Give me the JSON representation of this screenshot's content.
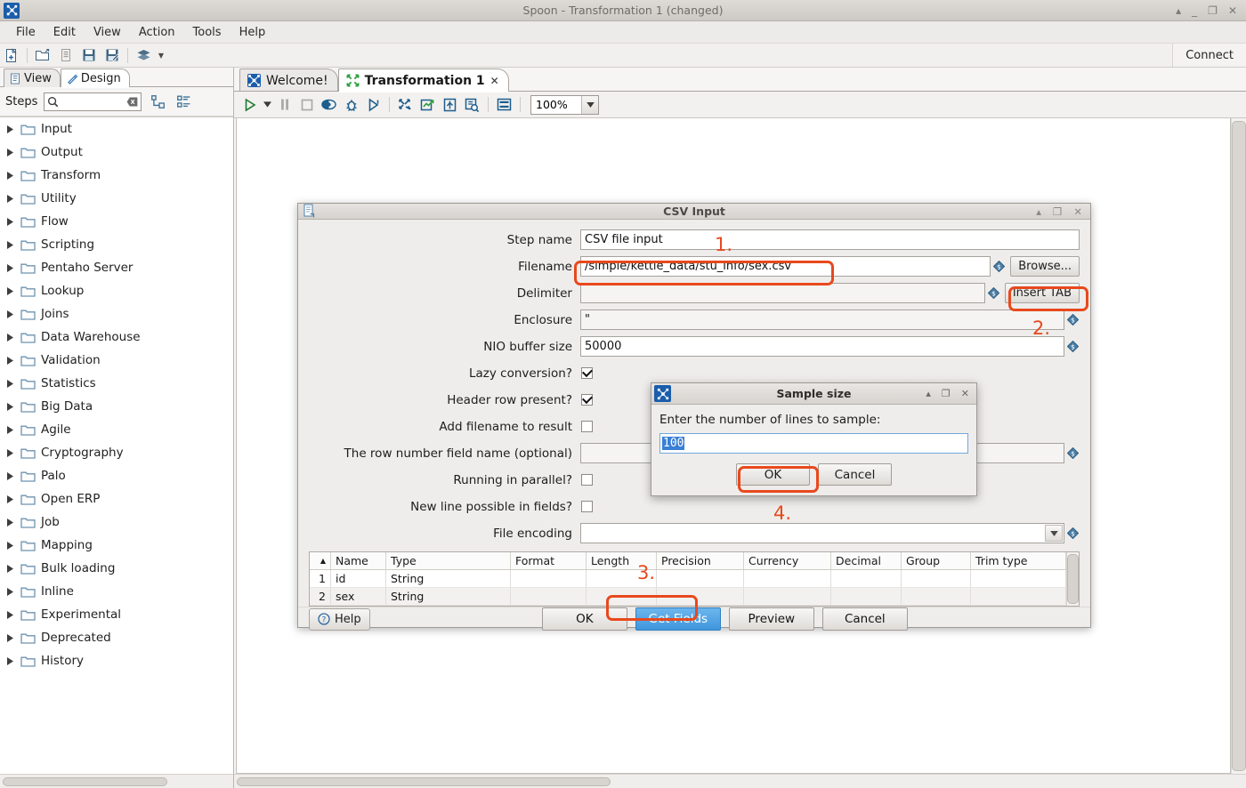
{
  "window": {
    "title": "Spoon - Transformation 1 (changed)",
    "buttons": {
      "minimize": "▴",
      "restore": "_",
      "maximize": "❐",
      "close": "✕"
    }
  },
  "menubar": {
    "items": [
      "File",
      "Edit",
      "View",
      "Action",
      "Tools",
      "Help"
    ]
  },
  "main_toolbar": {
    "connect_label": "Connect",
    "icons": [
      "new-file-icon",
      "open-folder-icon",
      "explorer-icon",
      "save-icon",
      "save-as-icon",
      "layers-icon",
      "dropdown-caret-icon"
    ]
  },
  "left_panel": {
    "tabs": [
      {
        "label": "View",
        "icon": "document-icon",
        "active": false
      },
      {
        "label": "Design",
        "icon": "pencil-icon",
        "active": true
      }
    ],
    "steps_label": "Steps",
    "search": {
      "value": "",
      "placeholder": ""
    },
    "tree_items": [
      "Input",
      "Output",
      "Transform",
      "Utility",
      "Flow",
      "Scripting",
      "Pentaho Server",
      "Lookup",
      "Joins",
      "Data Warehouse",
      "Validation",
      "Statistics",
      "Big Data",
      "Agile",
      "Cryptography",
      "Palo",
      "Open ERP",
      "Job",
      "Mapping",
      "Bulk loading",
      "Inline",
      "Experimental",
      "Deprecated",
      "History"
    ]
  },
  "editor": {
    "tabs": [
      {
        "label": "Welcome!",
        "icon": "spoon-icon",
        "active": false,
        "closable": false
      },
      {
        "label": "Transformation 1",
        "icon": "transformation-icon",
        "active": true,
        "closable": true,
        "close_glyph": "✕"
      }
    ],
    "zoom": {
      "value": "100%"
    },
    "toolbar_icons": [
      "run-icon",
      "run-options-caret-icon",
      "pause-icon",
      "stop-icon",
      "preview-icon",
      "debug-icon",
      "replay-icon",
      "transformation-metrics-icon",
      "transformation-log-icon",
      "step-metrics-icon",
      "inspect-data-icon",
      "grid-icon"
    ]
  },
  "csv_dialog": {
    "title": "CSV Input",
    "window_buttons": {
      "minimize": "▴",
      "maximize": "❐",
      "close": "✕"
    },
    "fields": [
      {
        "label": "Step name",
        "value": "CSV file input",
        "type": "text",
        "variable": false,
        "button": null
      },
      {
        "label": "Filename",
        "value": "/simple/kettle_data/stu_info/sex.csv",
        "type": "text",
        "variable": true,
        "button": "Browse..."
      },
      {
        "label": "Delimiter",
        "value": "",
        "type": "text",
        "variable": true,
        "button": "Insert TAB"
      },
      {
        "label": "Enclosure",
        "value": "\"",
        "type": "text",
        "variable": true,
        "button": null
      },
      {
        "label": "NIO buffer size",
        "value": "50000",
        "type": "text",
        "variable": true,
        "button": null
      },
      {
        "label": "Lazy conversion?",
        "value": true,
        "type": "checkbox",
        "variable": false,
        "button": null
      },
      {
        "label": "Header row present?",
        "value": true,
        "type": "checkbox",
        "variable": false,
        "button": null
      },
      {
        "label": "Add filename to result",
        "value": false,
        "type": "checkbox",
        "variable": false,
        "button": null
      },
      {
        "label": "The row number field name (optional)",
        "value": "",
        "type": "text",
        "variable": true,
        "button": null
      },
      {
        "label": "Running in parallel?",
        "value": false,
        "type": "checkbox",
        "variable": false,
        "button": null
      },
      {
        "label": "New line possible in fields?",
        "value": false,
        "type": "checkbox",
        "variable": false,
        "button": null
      },
      {
        "label": "File encoding",
        "value": "",
        "type": "select",
        "variable": true,
        "button": null
      }
    ],
    "table": {
      "columns": [
        "",
        "Name",
        "Type",
        "Format",
        "Length",
        "Precision",
        "Currency",
        "Decimal",
        "Group",
        "Trim type"
      ],
      "sort_indicator": "▲",
      "rows": [
        {
          "idx": "1",
          "Name": "id",
          "Type": "String",
          "Format": "",
          "Length": "",
          "Precision": "",
          "Currency": "",
          "Decimal": "",
          "Group": "",
          "Trim type": ""
        },
        {
          "idx": "2",
          "Name": "sex",
          "Type": "String",
          "Format": "",
          "Length": "",
          "Precision": "",
          "Currency": "",
          "Decimal": "",
          "Group": "",
          "Trim type": ""
        }
      ]
    },
    "footer": {
      "help": "Help",
      "ok": "OK",
      "get_fields": "Get Fields",
      "preview": "Preview",
      "cancel": "Cancel"
    }
  },
  "sample_dialog": {
    "title": "Sample size",
    "window_buttons": {
      "minimize": "▴",
      "maximize": "❐",
      "close": "✕"
    },
    "prompt": "Enter the number of lines to sample:",
    "input_value": "100",
    "ok": "OK",
    "cancel": "Cancel"
  },
  "annotations": {
    "accent_color": "#e8491d",
    "markers": [
      {
        "label": "1.",
        "target": "step-name-row"
      },
      {
        "label": "2.",
        "target": "insert-tab-button"
      },
      {
        "label": "3.",
        "target": "get-fields-button"
      },
      {
        "label": "4.",
        "target": "sample-ok-button"
      }
    ]
  }
}
